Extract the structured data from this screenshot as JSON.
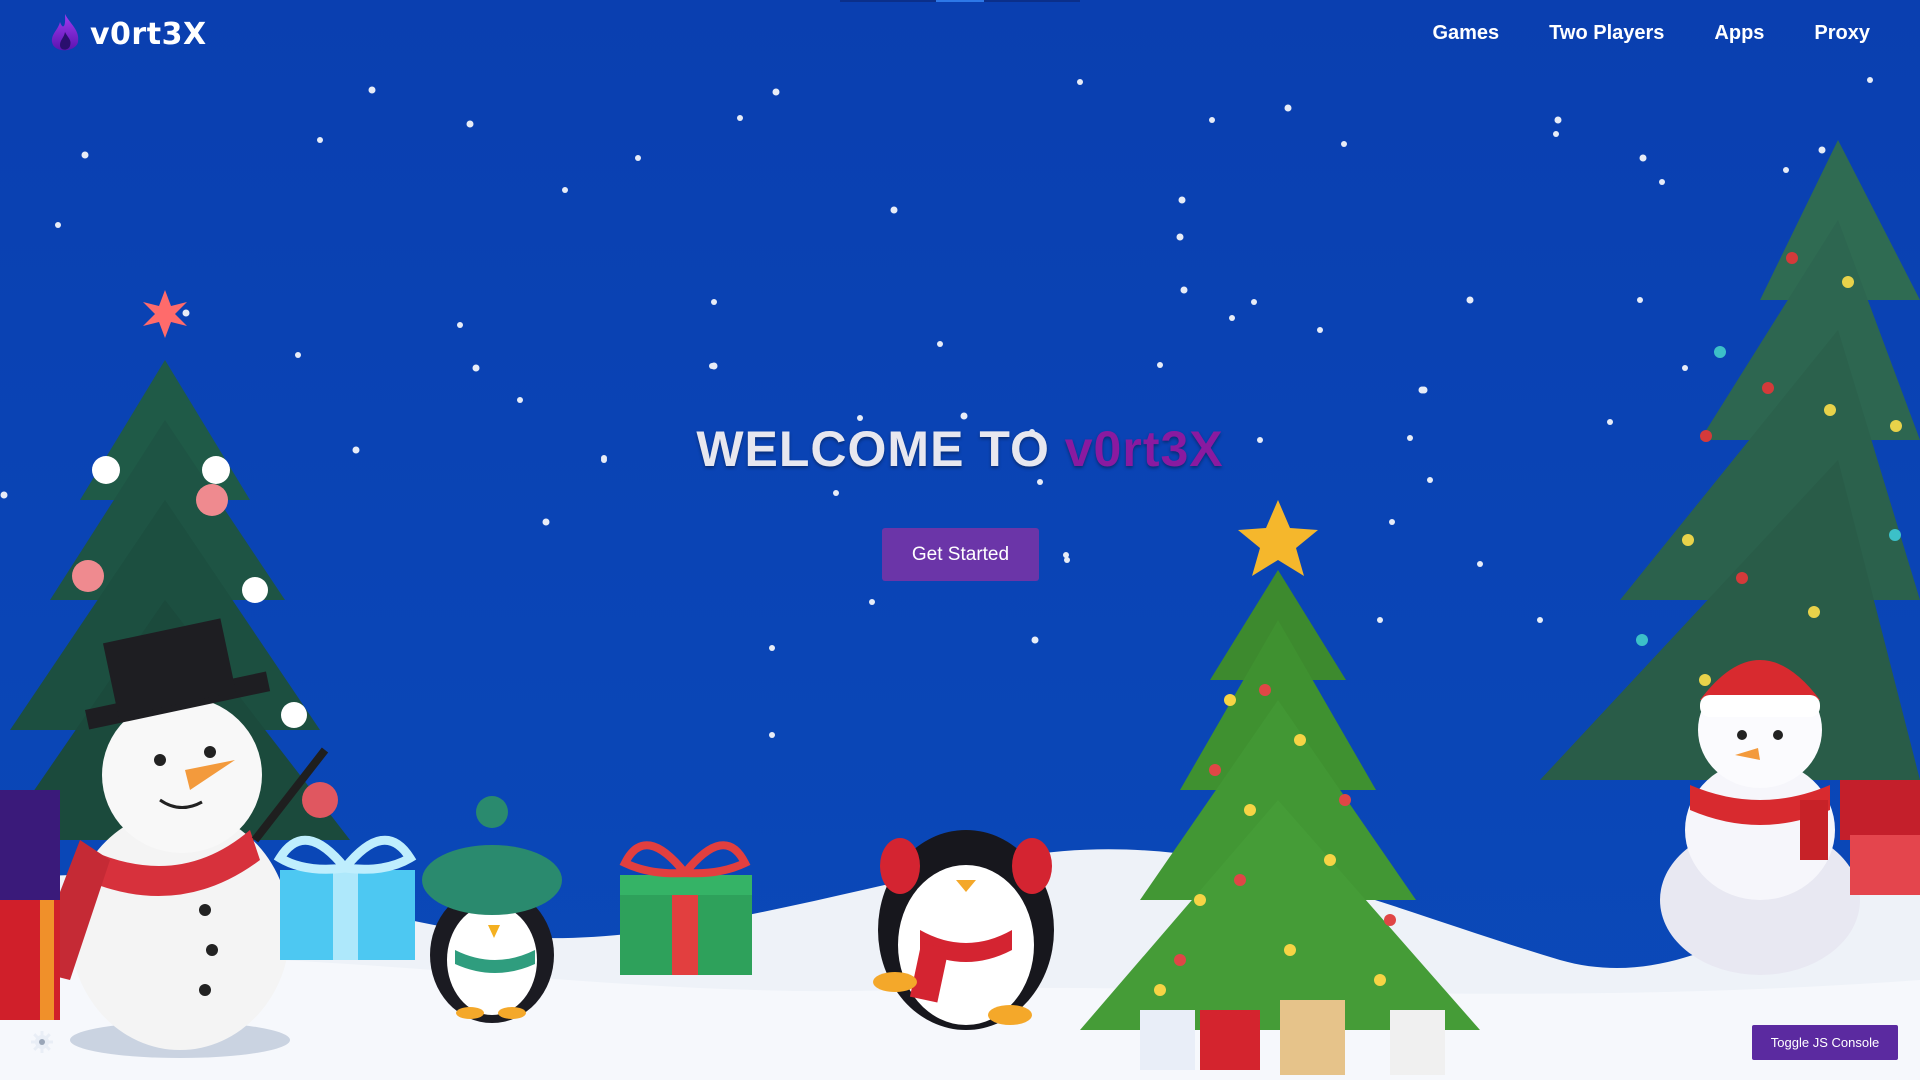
{
  "logo": {
    "text": "v0rt3X",
    "icon": "flame-icon"
  },
  "nav": {
    "items": [
      "Games",
      "Two Players",
      "Apps",
      "Proxy"
    ]
  },
  "hero": {
    "title_prefix": "WELCOME TO ",
    "title_brand": "v0rt3X",
    "cta_label": "Get Started"
  },
  "console": {
    "toggle_label": "Toggle JS Console"
  },
  "settings": {
    "icon": "gear-icon"
  },
  "colors": {
    "background": "#0a3fb0",
    "brand_purple": "#8a1aa0",
    "button_purple": "#6b35a8",
    "snow": "#eef2f8"
  }
}
